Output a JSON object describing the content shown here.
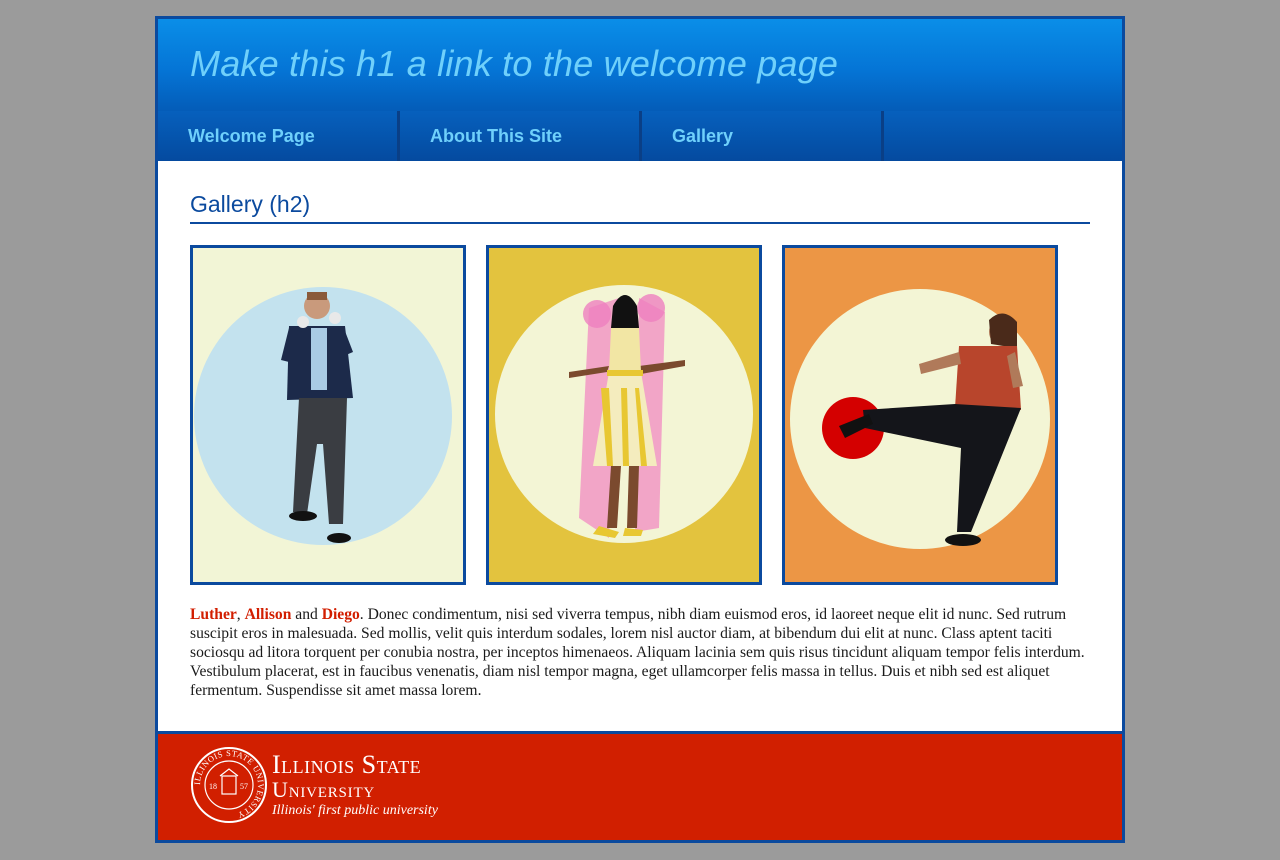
{
  "header": {
    "title": "Make this h1 a link to the welcome page"
  },
  "nav": {
    "items": [
      "Welcome Page",
      "About This Site",
      "Gallery"
    ]
  },
  "main": {
    "heading": "Gallery (h2)",
    "images": [
      {
        "alt": "Luther",
        "background": "#f2f5d6",
        "circle": "#c3e2ee"
      },
      {
        "alt": "Allison",
        "background": "#e3c33e",
        "circle": "#f3f5d5"
      },
      {
        "alt": "Diego",
        "background": "#ec9645",
        "circle": "#f3f5d5"
      }
    ],
    "caption": {
      "name1": "Luther",
      "sep1": ", ",
      "name2": "Allison",
      "sep2": " and ",
      "name3": "Diego",
      "body": ". Donec condimentum, nisi sed viverra tempus, nibh diam euismod eros, id laoreet neque elit id nunc. Sed rutrum suscipit eros in malesuada. Sed mollis, velit quis interdum sodales, lorem nisl auctor diam, at bibendum dui elit at nunc. Class aptent taciti sociosqu ad litora torquent per conubia nostra, per inceptos himenaeos. Aliquam lacinia sem quis risus tincidunt aliquam tempor felis interdum. Vestibulum placerat, est in faucibus venenatis, diam nisl tempor magna, eget ullamcorper felis massa in tellus. Duis et nibh sed est aliquet fermentum. Suspendisse sit amet massa lorem."
    }
  },
  "footer": {
    "wordmark_line1": "Illinois State",
    "wordmark_line2": "University",
    "tagline": "Illinois' first public university",
    "seal_text": "ILLINOIS STATE UNIVERSITY",
    "seal_year_left": "18",
    "seal_year_right": "57"
  },
  "colors": {
    "brand_blue": "#0b4a9e",
    "header_text": "#6fd0fb",
    "link_red": "#d21e00",
    "footer_red": "#d11f00",
    "page_background": "#9b9b9b"
  }
}
